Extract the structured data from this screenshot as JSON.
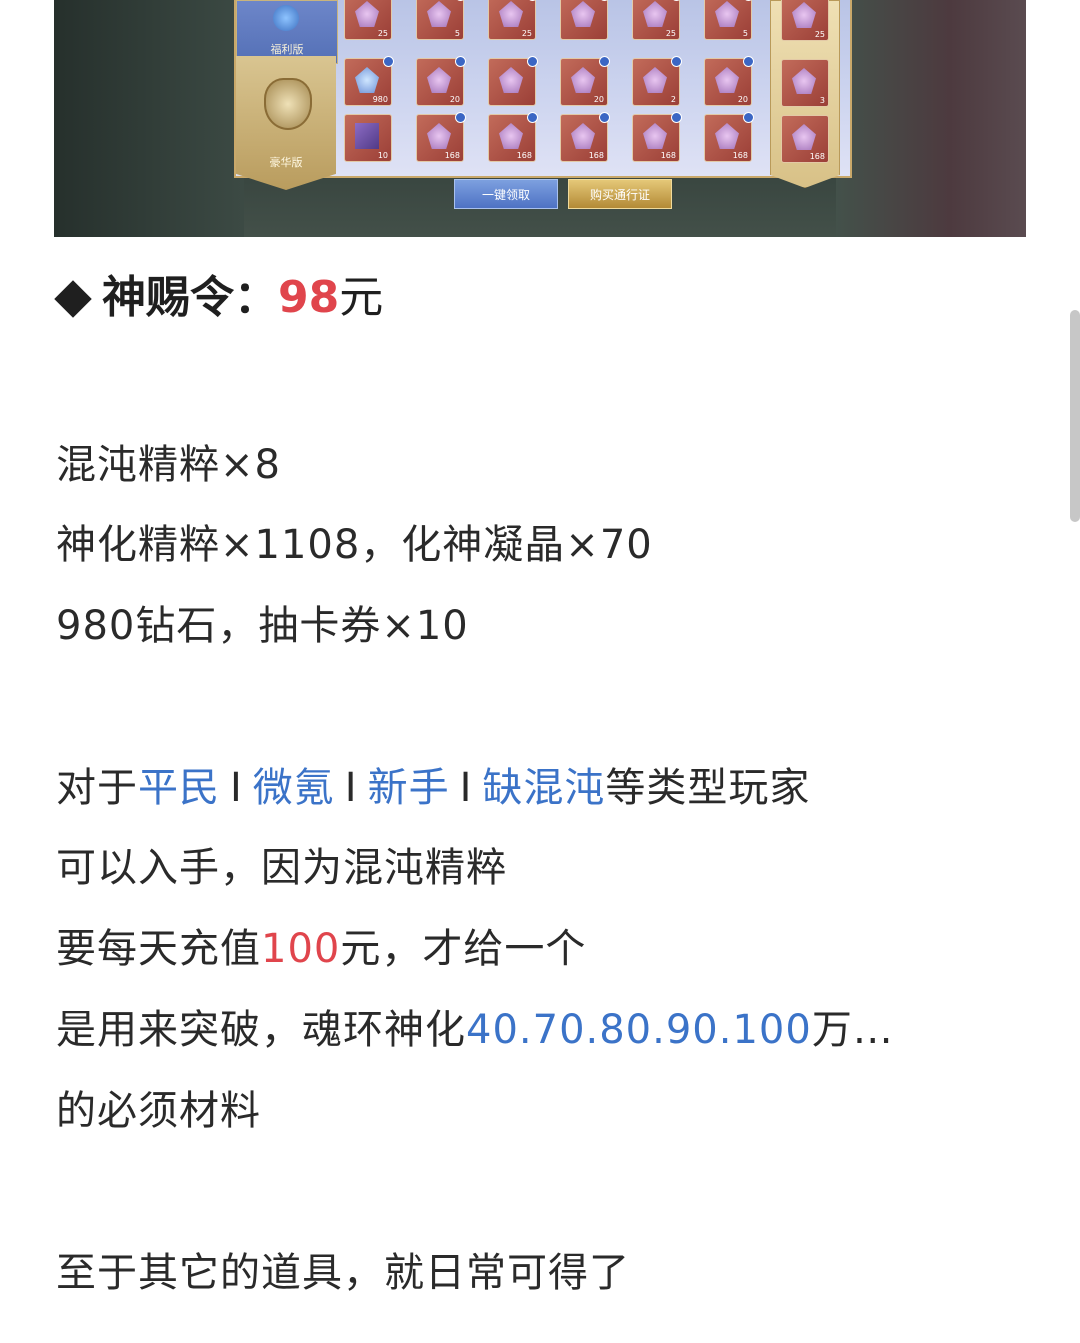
{
  "banner": {
    "welfare_tab": "福利版",
    "luxury_tab": "豪华版",
    "row1_counts": [
      "25",
      "5",
      "25",
      "",
      "25",
      "5",
      "25"
    ],
    "row2_counts": [
      "980",
      "20",
      "",
      "20",
      "2",
      "20",
      "3"
    ],
    "row3_counts": [
      "10",
      "168",
      "168",
      "168",
      "168",
      "168",
      "168"
    ],
    "claim_all_button": "一键领取",
    "buy_pass_button": "购买通行证"
  },
  "heading": {
    "prefix": "神赐令：",
    "price": "98",
    "unit": "元"
  },
  "rewards": {
    "line1": "混沌精粹×8",
    "line2": "神化精粹×1108，化神凝晶×70",
    "line3": "980钻石，抽卡券×10"
  },
  "advice": {
    "intro": "对于",
    "tag1": "平民",
    "tag2": "微氪",
    "tag3": "新手",
    "tag4": "缺混沌",
    "separator": "I",
    "suffix": "等类型玩家",
    "line2": "可以入手，因为混沌精粹",
    "line3_prefix": "要每天充值",
    "line3_amount": "100",
    "line3_suffix": "元，才给一个",
    "line4_prefix": "是用来突破，魂环神化",
    "line4_levels": "40.70.80.90.100",
    "line4_suffix": "万…",
    "line5": "的必须材料",
    "line6": "至于其它的道具，就日常可得了"
  },
  "colors": {
    "price_red": "#e0454c",
    "highlight_blue": "#3b73c8"
  }
}
